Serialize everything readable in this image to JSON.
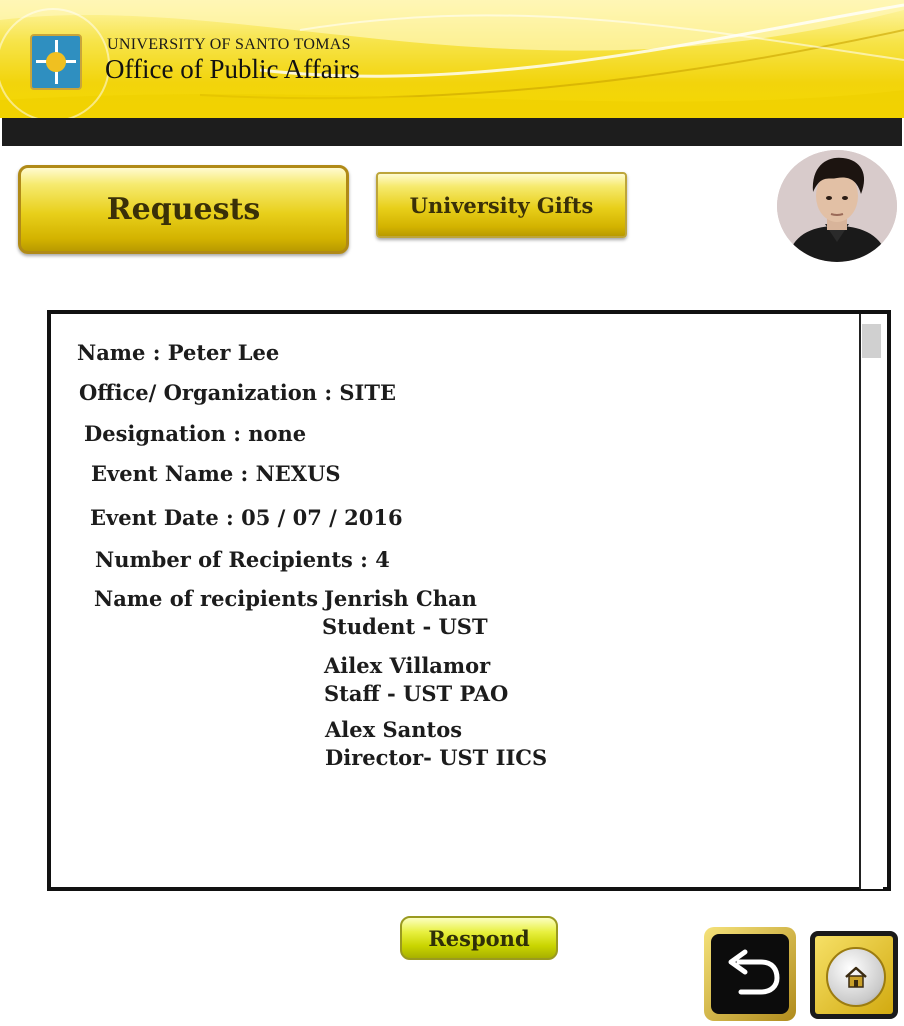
{
  "header": {
    "university": "UNIVERSITY OF SANTO TOMAS",
    "office": "Office of Public Affairs"
  },
  "tabs": {
    "requests_label": "Requests",
    "gifts_label": "University Gifts"
  },
  "request": {
    "name": "Name : Peter Lee",
    "organization": "Office/ Organization : SITE",
    "designation": "Designation : none",
    "event_name": "Event Name : NEXUS",
    "event_date": "Event Date : 05 / 07 / 2016",
    "recipient_count": "Number of Recipients : 4",
    "recipients_label": "Name of recipients :",
    "recipients": [
      {
        "name": "Jenrish Chan",
        "role": "Student  - UST"
      },
      {
        "name": "Ailex Villamor",
        "role": "Staff - UST PAO"
      },
      {
        "name": "Alex Santos",
        "role": "Director- UST IICS"
      }
    ]
  },
  "actions": {
    "respond_label": "Respond"
  },
  "icons": {
    "back": "back-arrow-icon",
    "home": "home-icon",
    "logo": "university-seal-icon"
  },
  "colors": {
    "accent_gold": "#e8cf1a",
    "bar_black": "#1d1d1d"
  }
}
